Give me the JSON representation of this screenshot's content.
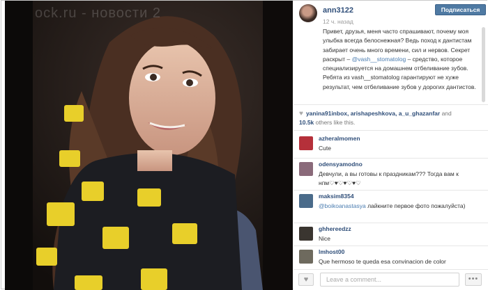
{
  "photo": {
    "watermark": "ock.ru - новости 2"
  },
  "post": {
    "username": "ann3122",
    "follow_label": "Подписаться",
    "time": "12 ч. назад",
    "caption_part1": "Привет, друзья, меня часто спрашивают, почему моя улыбка всегда белоснежная? Ведь поход к дантистам забирает очень много времени, сил и нервов. Секрет раскрыт – ",
    "caption_mention": "@vash__stomatolog",
    "caption_part2": " – средство, которое специализируется на домашнем отбеливание зубов. Ребята из vash__stomatolog гарантируют не хуже результат, чем отбеливание зубов у дорогих дантистов.",
    "likes": {
      "names": "yanina91inbox, arishapeshkova, a_u_ghazanfar",
      "and": " and",
      "count": "10.5k",
      "suffix": " others like this."
    }
  },
  "comments": [
    {
      "user": "azheralmomen",
      "text": "Cute",
      "avatar_color": "#b5303a"
    },
    {
      "user": "odensyamodno",
      "text": "Девчули, а вы готовы к праздникам??? Тогда вам к нпм♡♥♡♥♡♥♡",
      "avatar_color": "#8a6a7a"
    },
    {
      "user": "maksim8354",
      "mention": "@boikoanastasya",
      "text": " лайкните первое фото пожалуйста)",
      "avatar_color": "#4a6b8a"
    },
    {
      "user": "ghhereedzz",
      "text": "Nice",
      "avatar_color": "#3a3530"
    },
    {
      "user": "lmhost00",
      "text": "Que hermoso te queda esa convinacion de color",
      "avatar_color": "#6e6a5e"
    }
  ],
  "footer": {
    "comment_placeholder": "Leave a comment...",
    "like_icon": "heart-icon",
    "more_icon": "ellipsis-icon",
    "more_label": "•••"
  },
  "colors": {
    "username": "#2f4e79",
    "button": "#4f7aa3",
    "mention": "#4a7cb0"
  }
}
